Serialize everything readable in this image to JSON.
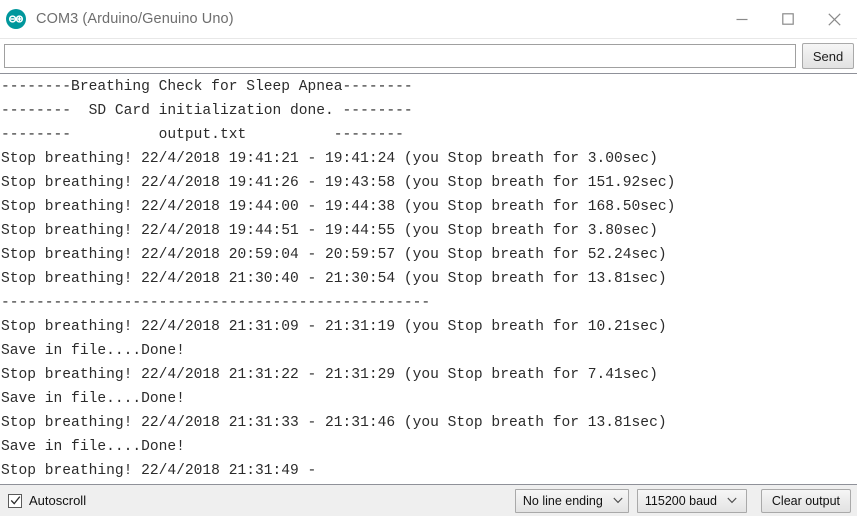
{
  "window": {
    "title": "COM3 (Arduino/Genuino Uno)",
    "app_icon": "arduino-logo-icon",
    "controls": {
      "minimize": "minimize-icon",
      "maximize": "maximize-icon",
      "close": "close-icon"
    },
    "accent_color": "#00979C"
  },
  "send_row": {
    "input_value": "",
    "input_placeholder": "",
    "send_label": "Send"
  },
  "console": {
    "lines": [
      "--------Breathing Check for Sleep Apnea--------",
      "--------  SD Card initialization done. --------",
      "--------          output.txt          --------",
      "Stop breathing! 22/4/2018 19:41:21 - 19:41:24 (you Stop breath for 3.00sec)",
      "Stop breathing! 22/4/2018 19:41:26 - 19:43:58 (you Stop breath for 151.92sec)",
      "Stop breathing! 22/4/2018 19:44:00 - 19:44:38 (you Stop breath for 168.50sec)",
      "Stop breathing! 22/4/2018 19:44:51 - 19:44:55 (you Stop breath for 3.80sec)",
      "Stop breathing! 22/4/2018 20:59:04 - 20:59:57 (you Stop breath for 52.24sec)",
      "Stop breathing! 22/4/2018 21:30:40 - 21:30:54 (you Stop breath for 13.81sec)",
      "-------------------------------------------------",
      "Stop breathing! 22/4/2018 21:31:09 - 21:31:19 (you Stop breath for 10.21sec)",
      "Save in file....Done!",
      "Stop breathing! 22/4/2018 21:31:22 - 21:31:29 (you Stop breath for 7.41sec)",
      "Save in file....Done!",
      "Stop breathing! 22/4/2018 21:31:33 - 21:31:46 (you Stop breath for 13.81sec)",
      "Save in file....Done!",
      "Stop breathing! 22/4/2018 21:31:49 - "
    ]
  },
  "status_bar": {
    "autoscroll_label": "Autoscroll",
    "autoscroll_checked": true,
    "line_ending_value": "No line ending",
    "baud_value": "115200 baud",
    "clear_output_label": "Clear output"
  }
}
